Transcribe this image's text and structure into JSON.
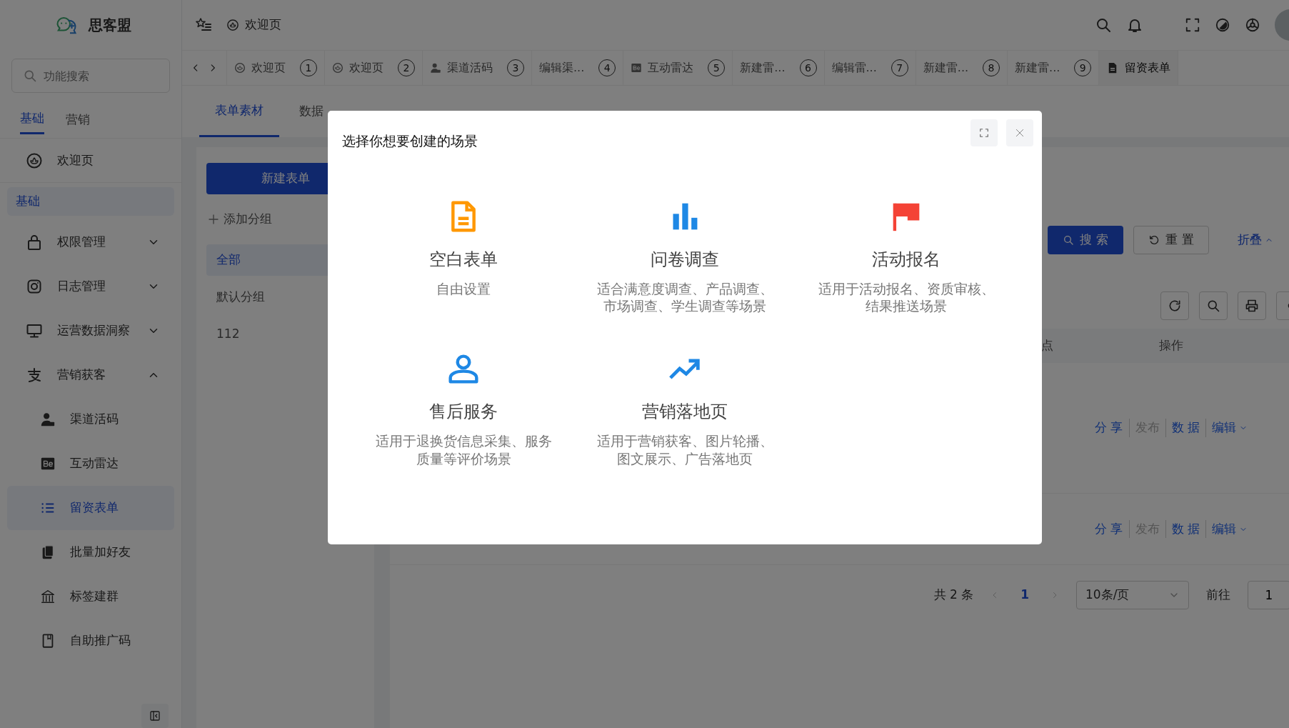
{
  "sidebar": {
    "logo": "思客盟",
    "search": {
      "placeholder": "功能搜索"
    },
    "tabs": [
      {
        "label": "基础",
        "selected": true
      },
      {
        "label": "营销",
        "selected": false
      }
    ],
    "home": "欢迎页",
    "section": "基础",
    "items": [
      {
        "label": "权限管理",
        "expanded": false
      },
      {
        "label": "日志管理",
        "expanded": false
      },
      {
        "label": "运营数据洞察",
        "expanded": false
      },
      {
        "label": "营销获客",
        "expanded": true,
        "children": [
          {
            "label": "渠道活码",
            "selected": false
          },
          {
            "label": "互动雷达",
            "selected": false
          },
          {
            "label": "留资表单",
            "selected": true
          },
          {
            "label": "批量加好友",
            "selected": false
          },
          {
            "label": "标签建群",
            "selected": false
          },
          {
            "label": "自助推广码",
            "selected": false
          }
        ]
      }
    ]
  },
  "header": {
    "breadcrumb": "欢迎页"
  },
  "page_tabs": [
    {
      "label": "欢迎页",
      "number": "1",
      "selected": false
    },
    {
      "label": "欢迎页",
      "number": "2",
      "selected": false
    },
    {
      "label": "渠道活码",
      "number": "3",
      "selected": false
    },
    {
      "label": "编辑渠...",
      "number": "4",
      "selected": false
    },
    {
      "label": "互动雷达",
      "number": "5",
      "selected": false
    },
    {
      "label": "新建雷...",
      "number": "6",
      "selected": false
    },
    {
      "label": "编辑雷...",
      "number": "7",
      "selected": false
    },
    {
      "label": "新建雷...",
      "number": "8",
      "selected": false
    },
    {
      "label": "新建雷...",
      "number": "9",
      "selected": false
    },
    {
      "label": "留资表单",
      "selected": true
    }
  ],
  "content_tabs": [
    {
      "label": "表单素材",
      "selected": true
    },
    {
      "label": "数据",
      "selected": false
    }
  ],
  "groups": {
    "new_button": "新建表单",
    "add_group": "添加分组",
    "items": [
      {
        "label": "全部",
        "selected": true
      },
      {
        "label": "默认分组",
        "selected": false
      },
      {
        "label": "112",
        "selected": false
      }
    ]
  },
  "filter": {
    "search_button": "搜 索",
    "reset_button": "重 置",
    "collapse": "折叠"
  },
  "table": {
    "columns": [
      "点",
      "操作"
    ],
    "rows": [
      {
        "actions": [
          {
            "label": "分 享",
            "disabled": false
          },
          {
            "label": "发布",
            "disabled": true
          },
          {
            "label": "数 据",
            "disabled": false
          },
          {
            "label": "编辑",
            "disabled": false
          }
        ]
      },
      {
        "actions": [
          {
            "label": "分 享",
            "disabled": false
          },
          {
            "label": "发布",
            "disabled": true
          },
          {
            "label": "数 据",
            "disabled": false
          },
          {
            "label": "编辑",
            "disabled": false
          }
        ]
      }
    ]
  },
  "pagination": {
    "total": "共 2 条",
    "pages": [
      {
        "label": "1",
        "selected": true
      }
    ],
    "page_size": "10条/页",
    "goto_label": "前往",
    "goto_value": "1"
  },
  "dialog": {
    "title": "选择你想要创建的场景",
    "options": [
      {
        "title": "空白表单",
        "description": "自由设置"
      },
      {
        "title": "问卷调查",
        "description": "适合满意度调查、产品调查、市场调查、学生调查等场景"
      },
      {
        "title": "活动报名",
        "description": "适用于活动报名、资质审核、结果推送场景"
      },
      {
        "title": "售后服务",
        "description": "适用于退换货信息采集、服务质量等评价场景"
      },
      {
        "title": "营销落地页",
        "description": "适用于营销获客、图片轮播、图文展示、广告落地页"
      }
    ]
  }
}
